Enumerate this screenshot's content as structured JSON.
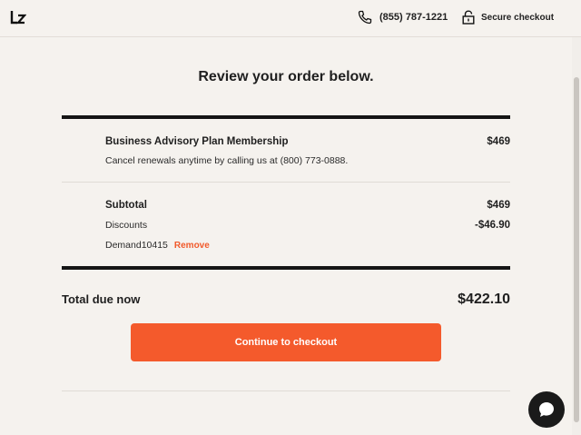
{
  "header": {
    "logo_text": "LZ",
    "phone": "(855) 787-1221",
    "secure_label": "Secure checkout"
  },
  "page_title": "Review your order below.",
  "order_item": {
    "name": "Business Advisory Plan Membership",
    "price": "$469",
    "note": "Cancel renewals anytime by calling us at (800) 773-0888."
  },
  "summary": {
    "subtotal_label": "Subtotal",
    "subtotal_value": "$469",
    "discounts_label": "Discounts",
    "discounts_value": "-$46.90",
    "promo_code": "Demand10415",
    "remove_label": "Remove"
  },
  "total": {
    "label": "Total due now",
    "value": "$422.10"
  },
  "cta": {
    "label": "Continue to checkout"
  },
  "colors": {
    "accent": "#f45a2c",
    "background": "#f5f2ee",
    "dark": "#151515"
  },
  "icons": [
    "lz-logo-icon",
    "phone-icon",
    "lock-icon",
    "chat-icon"
  ]
}
